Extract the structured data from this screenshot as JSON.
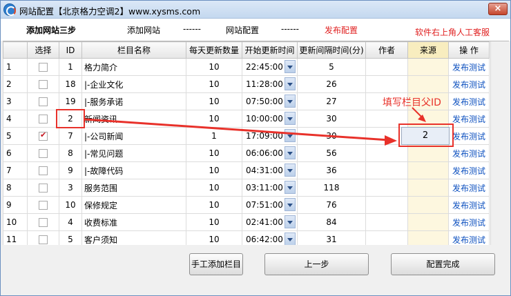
{
  "window": {
    "title": "网站配置【北京格力空调2】www.xysms.com",
    "close_label": "×"
  },
  "steps": {
    "current": "添加网站三步",
    "step1": "添加网站",
    "sep1": "------",
    "step2": "网站配置",
    "sep2": "------",
    "step3": "发布配置",
    "support": "软件右上角人工客服"
  },
  "table": {
    "headers": {
      "row": "",
      "select": "选择",
      "id": "ID",
      "name": "栏目名称",
      "daily": "每天更新数量",
      "start": "开始更新时间",
      "interval": "更新间隔时间(分)",
      "author": "作者",
      "source": "来源",
      "action": "操 作"
    },
    "rows": [
      {
        "n": "1",
        "checked": false,
        "id": "1",
        "name": "格力简介",
        "daily": "10",
        "start": "22:45:00",
        "interval": "5",
        "author": "",
        "source": "",
        "action": "发布测试"
      },
      {
        "n": "2",
        "checked": false,
        "id": "18",
        "name": "|-企业文化",
        "daily": "10",
        "start": "11:28:00",
        "interval": "26",
        "author": "",
        "source": "",
        "action": "发布测试"
      },
      {
        "n": "3",
        "checked": false,
        "id": "19",
        "name": "|-服务承诺",
        "daily": "10",
        "start": "07:50:00",
        "interval": "27",
        "author": "",
        "source": "",
        "action": "发布测试"
      },
      {
        "n": "4",
        "checked": false,
        "id": "2",
        "name": "新闻资讯",
        "daily": "10",
        "start": "10:00:00",
        "interval": "30",
        "author": "",
        "source": "",
        "action": "发布测试"
      },
      {
        "n": "5",
        "checked": true,
        "id": "7",
        "name": "|-公司新闻",
        "daily": "1",
        "start": "17:09:00",
        "interval": "30",
        "author": "",
        "source": "",
        "action": "发布测试"
      },
      {
        "n": "6",
        "checked": false,
        "id": "8",
        "name": "|-常见问题",
        "daily": "10",
        "start": "06:06:00",
        "interval": "56",
        "author": "",
        "source": "",
        "action": "发布测试"
      },
      {
        "n": "7",
        "checked": false,
        "id": "9",
        "name": "|-故障代码",
        "daily": "10",
        "start": "04:31:00",
        "interval": "36",
        "author": "",
        "source": "",
        "action": "发布测试"
      },
      {
        "n": "8",
        "checked": false,
        "id": "3",
        "name": "服务范围",
        "daily": "10",
        "start": "03:11:00",
        "interval": "118",
        "author": "",
        "source": "",
        "action": "发布测试"
      },
      {
        "n": "9",
        "checked": false,
        "id": "10",
        "name": "保修规定",
        "daily": "10",
        "start": "07:51:00",
        "interval": "76",
        "author": "",
        "source": "",
        "action": "发布测试"
      },
      {
        "n": "10",
        "checked": false,
        "id": "4",
        "name": "收费标准",
        "daily": "10",
        "start": "02:41:00",
        "interval": "84",
        "author": "",
        "source": "",
        "action": "发布测试"
      },
      {
        "n": "11",
        "checked": false,
        "id": "5",
        "name": "客户须知",
        "daily": "10",
        "start": "06:42:00",
        "interval": "31",
        "author": "",
        "source": "",
        "action": "发布测试"
      }
    ]
  },
  "overlay": {
    "annotation": "填写栏目父ID",
    "source_value": "2",
    "arrow_color": "#e8312a"
  },
  "buttons": {
    "add_column": "手工添加栏目",
    "prev": "上一步",
    "done": "配置完成"
  }
}
